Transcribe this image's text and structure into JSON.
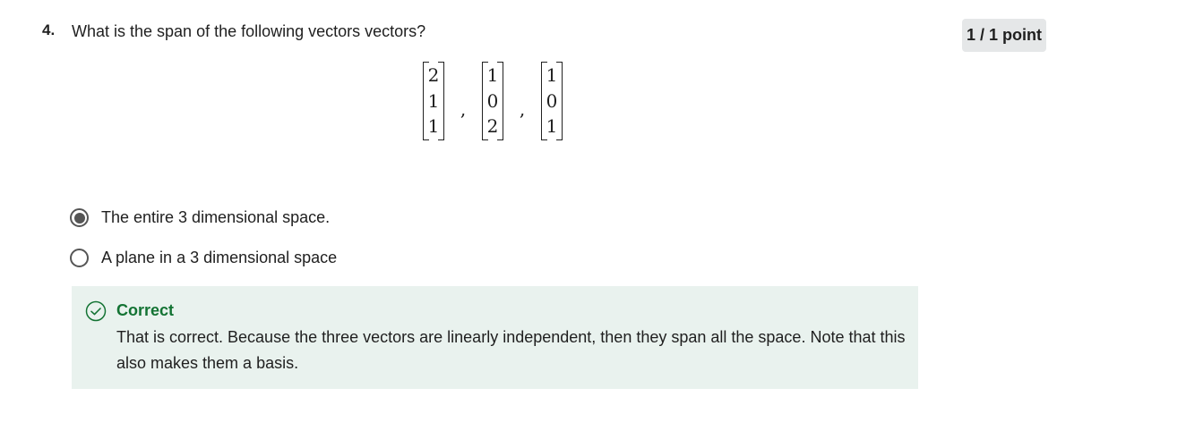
{
  "question": {
    "number": "4.",
    "text": "What is the span of the following vectors vectors?",
    "points": "1 / 1 point",
    "vectors": [
      [
        "2",
        "1",
        "1"
      ],
      [
        "1",
        "0",
        "2"
      ],
      [
        "1",
        "0",
        "1"
      ]
    ],
    "separator": ","
  },
  "options": [
    {
      "label": "The entire 3 dimensional space.",
      "selected": true
    },
    {
      "label": "A plane in a 3 dimensional space",
      "selected": false
    }
  ],
  "feedback": {
    "status": "Correct",
    "text": "That is correct. Because the three vectors are linearly independent, then they span all the space. Note that this also makes them a basis.",
    "icon": "check-circle-icon",
    "accent_color": "#137333",
    "background_color": "#e9f2ee"
  },
  "colors": {
    "badge_bg": "#e5e7e8",
    "radio": "#555555"
  }
}
